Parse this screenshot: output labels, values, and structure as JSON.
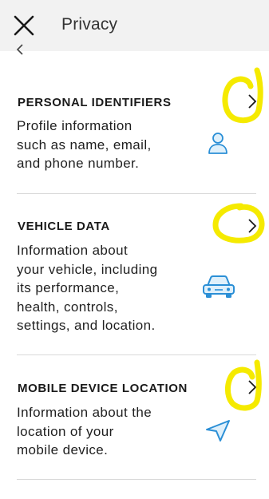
{
  "header": {
    "title": "Privacy",
    "close_icon": "close-icon"
  },
  "nav": {
    "back_icon": "chevron-left-icon"
  },
  "sections": [
    {
      "title": "PERSONAL IDENTIFIERS",
      "description": "Profile information\nsuch as name, email,\nand phone number.",
      "icon": "person-icon"
    },
    {
      "title": "VEHICLE DATA",
      "description": "Information about\nyour vehicle, including\nits performance,\nhealth, controls,\nsettings, and location.",
      "icon": "car-icon"
    },
    {
      "title": "MOBILE DEVICE LOCATION",
      "description": "Information about the\nlocation of your\nmobile device.",
      "icon": "location-arrow-icon"
    }
  ],
  "colors": {
    "icon_accent": "#2b8fd6",
    "highlight": "#f5ea00",
    "topbar": "#f2f2f2"
  }
}
